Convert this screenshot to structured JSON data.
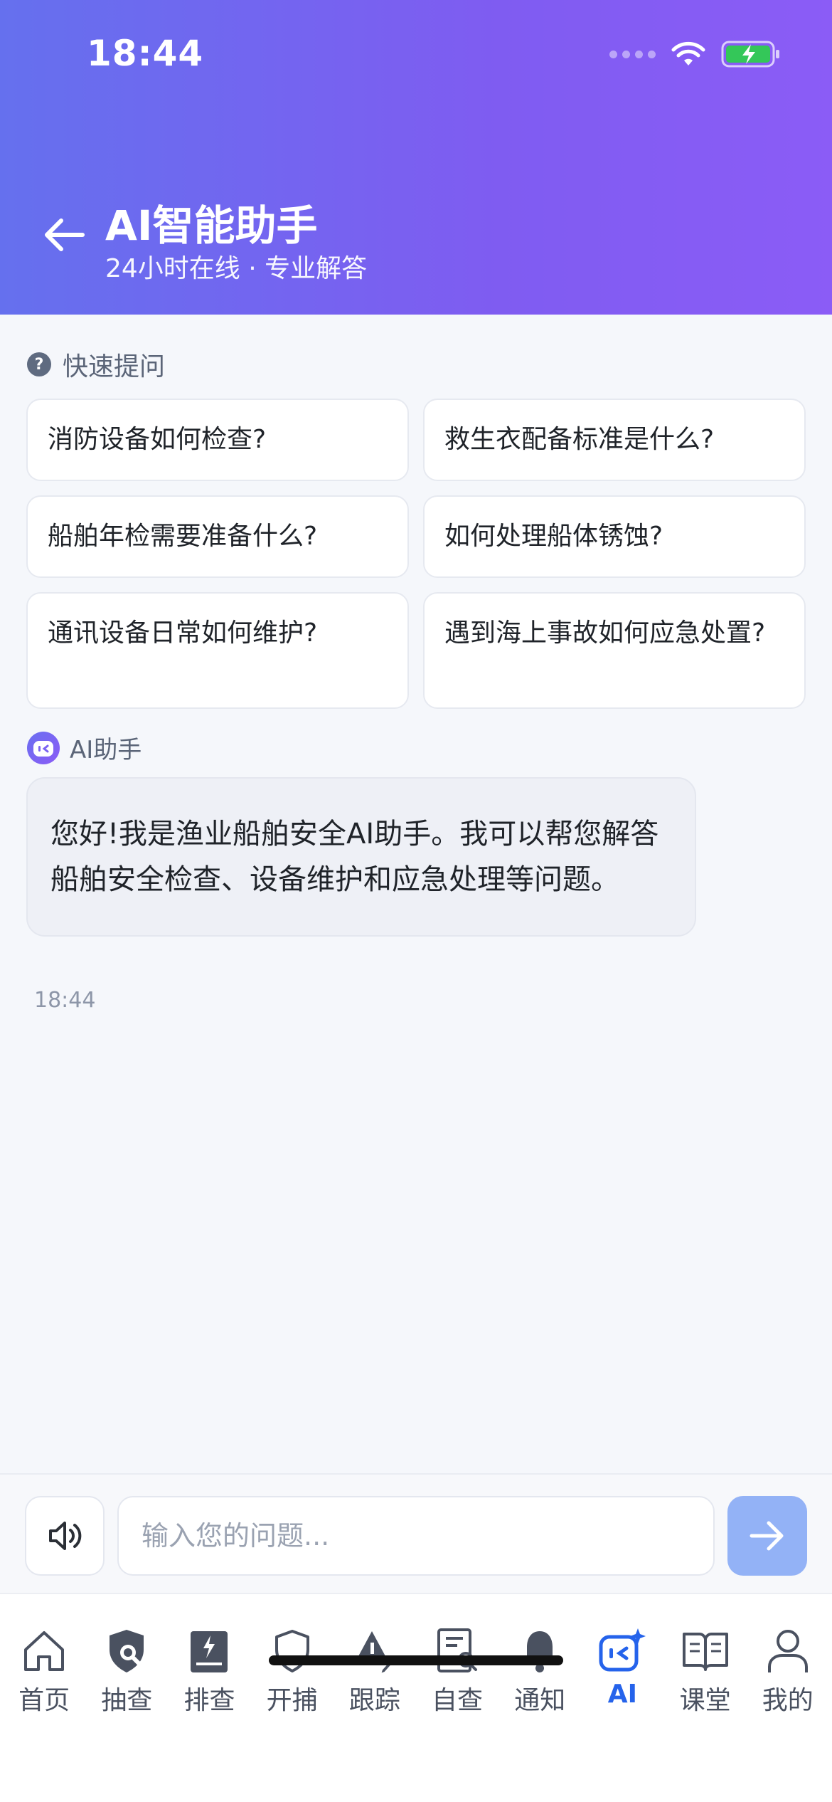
{
  "status": {
    "time": "18:44"
  },
  "header": {
    "title": "AI智能助手",
    "subtitle": "24小时在线 · 专业解答"
  },
  "quick": {
    "label": "快速提问",
    "items": [
      "消防设备如何检查?",
      "救生衣配备标准是什么?",
      "船舶年检需要准备什么?",
      "如何处理船体锈蚀?",
      "通讯设备日常如何维护?",
      "遇到海上事故如何应急处置?"
    ]
  },
  "chat": {
    "bot_name": "AI助手",
    "message": "您好!我是渔业船舶安全AI助手。我可以帮您解答船舶安全检查、设备维护和应急处理等问题。",
    "time": "18:44"
  },
  "input": {
    "placeholder": "输入您的问题..."
  },
  "nav": {
    "items": [
      {
        "label": "首页",
        "icon": "home-icon"
      },
      {
        "label": "抽查",
        "icon": "shield-search-icon"
      },
      {
        "label": "排查",
        "icon": "clipboard-bolt-icon"
      },
      {
        "label": "开捕",
        "icon": "shield-icon"
      },
      {
        "label": "跟踪",
        "icon": "warning-edit-icon"
      },
      {
        "label": "自查",
        "icon": "document-search-icon"
      },
      {
        "label": "通知",
        "icon": "bell-icon"
      },
      {
        "label": "AI",
        "icon": "ai-sparkle-icon"
      },
      {
        "label": "课堂",
        "icon": "book-icon"
      },
      {
        "label": "我的",
        "icon": "user-icon"
      }
    ],
    "active": "AI"
  },
  "colors": {
    "accent": "#2563eb",
    "header_start": "#6570ee",
    "header_end": "#8b5cf6",
    "send": "#93b2f6"
  }
}
